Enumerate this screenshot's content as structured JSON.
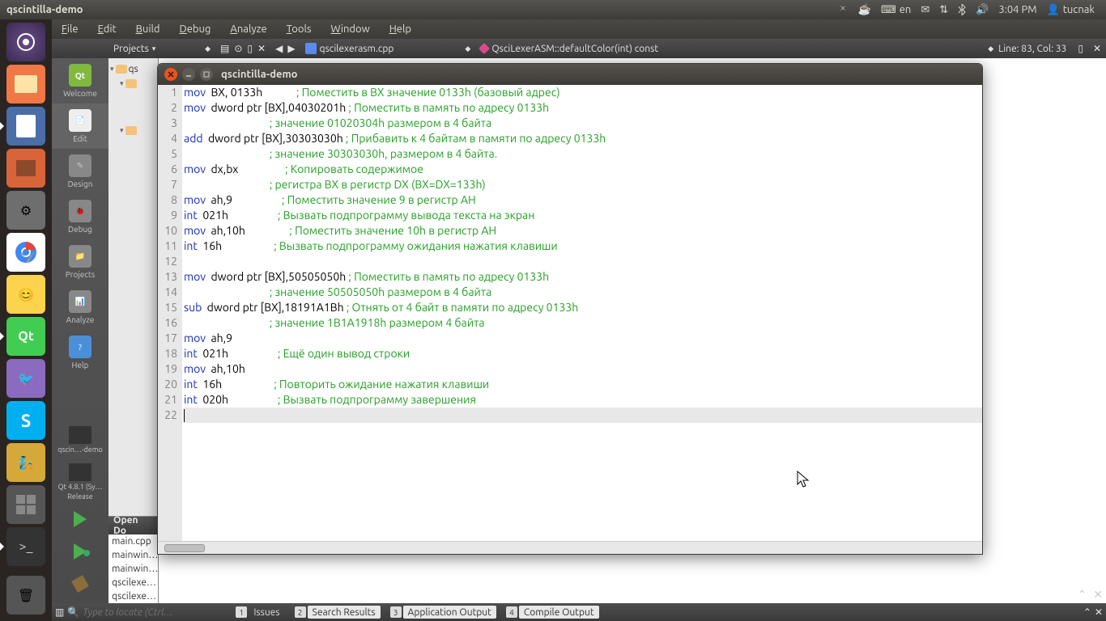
{
  "system_bar": {
    "app_title": "qscintilla-demo",
    "lang": "en",
    "time": "3:04 PM",
    "user": "tucnak"
  },
  "menubar": {
    "items": [
      "File",
      "Edit",
      "Build",
      "Debug",
      "Analyze",
      "Tools",
      "Window",
      "Help"
    ]
  },
  "toolbar": {
    "projects_label": "Projects",
    "file_tab": "qscilexerasm.cpp",
    "symbol": "QsciLexerASM::defaultColor(int) const",
    "line_col": "Line: 83, Col: 33"
  },
  "modebar": {
    "items": [
      "Welcome",
      "Edit",
      "Design",
      "Debug",
      "Projects",
      "Analyze",
      "Help"
    ],
    "kit1": "qscin…-demo",
    "kit2a": "Qt 4.8.1 (Sy…",
    "kit2b": "Release"
  },
  "opendocs": {
    "header": "Open Do",
    "files": [
      "main.cpp",
      "mainwin…",
      "mainwin…",
      "qscilexe…",
      "qscilexe…"
    ]
  },
  "demo_window": {
    "title": "qscintilla-demo"
  },
  "code_lines": [
    {
      "n": 1,
      "kw": "mov",
      "arg": "  BX, 0133h             ",
      "cm": "; Поместить в BX значение 0133h (базовый адрес)"
    },
    {
      "n": 2,
      "kw": "mov",
      "arg": "  dword ptr [BX],04030201h ",
      "cm": "; Поместить в память по адресу 0133h"
    },
    {
      "n": 3,
      "kw": "",
      "arg": "                              ",
      "cm": "; значение 01020304h размером в 4 байта"
    },
    {
      "n": 4,
      "kw": "add",
      "arg": "  dword ptr [BX],30303030h ",
      "cm": "; Прибавить к 4 байтам в памяти по адресу 0133h"
    },
    {
      "n": 5,
      "kw": "",
      "arg": "                              ",
      "cm": "; значение 30303030h, размером в 4 байта."
    },
    {
      "n": 6,
      "kw": "mov",
      "arg": "  dx,bx                  ",
      "cm": "; Копировать содержимое"
    },
    {
      "n": 7,
      "kw": "",
      "arg": "                              ",
      "cm": "; регистра BX в регистр DX (BX=DX=133h)"
    },
    {
      "n": 8,
      "kw": "mov",
      "arg": "  ah,9                   ",
      "cm": "; Поместить значение 9 в регистр AH"
    },
    {
      "n": 9,
      "kw": "int",
      "arg": "  021h                   ",
      "cm": "; Вызвать подпрограмму вывода текста на экран"
    },
    {
      "n": 10,
      "kw": "mov",
      "arg": "  ah,10h                 ",
      "cm": "; Поместить значение 10h в регистр AH"
    },
    {
      "n": 11,
      "kw": "int",
      "arg": "  16h                    ",
      "cm": "; Вызвать подпрограмму ожидания нажатия клавиши"
    },
    {
      "n": 12,
      "kw": "",
      "arg": "",
      "cm": ""
    },
    {
      "n": 13,
      "kw": "mov",
      "arg": "  dword ptr [BX],50505050h ",
      "cm": "; Поместить в память по адресу 0133h"
    },
    {
      "n": 14,
      "kw": "",
      "arg": "                              ",
      "cm": "; значение 50505050h размером в 4 байта"
    },
    {
      "n": 15,
      "kw": "sub",
      "arg": "  dword ptr [BX],18191A1Bh ",
      "cm": "; Отнять от 4 байт в памяти по адресу 0133h"
    },
    {
      "n": 16,
      "kw": "",
      "arg": "                              ",
      "cm": "; значение 1B1A1918h размером 4 байта"
    },
    {
      "n": 17,
      "kw": "mov",
      "arg": "  ah,9",
      "cm": ""
    },
    {
      "n": 18,
      "kw": "int",
      "arg": "  021h                   ",
      "cm": "; Ещё один вывод строки"
    },
    {
      "n": 19,
      "kw": "mov",
      "arg": "  ah,10h",
      "cm": ""
    },
    {
      "n": 20,
      "kw": "int",
      "arg": "  16h                    ",
      "cm": "; Повторить ожидание нажатия клавиши"
    },
    {
      "n": 21,
      "kw": "int",
      "arg": "  020h                   ",
      "cm": "; Вызвать подпрограмму завершения"
    },
    {
      "n": 22,
      "kw": "",
      "arg": "",
      "cm": "",
      "current": true
    }
  ],
  "bottom": {
    "search_placeholder": "Type to locate (Ctrl…",
    "tabs": [
      {
        "n": "1",
        "label": "Issues"
      },
      {
        "n": "2",
        "label": "Search Results"
      },
      {
        "n": "3",
        "label": "Application Output"
      },
      {
        "n": "4",
        "label": "Compile Output"
      }
    ]
  }
}
